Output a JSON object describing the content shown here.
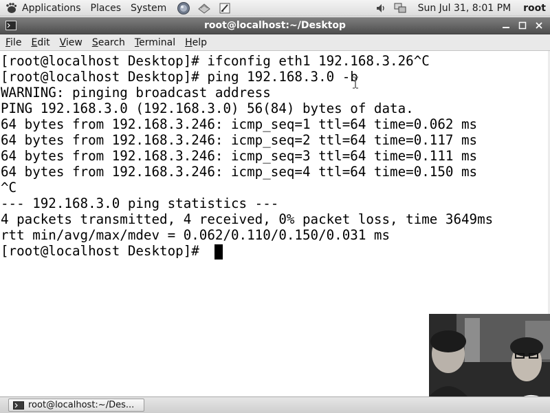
{
  "panel": {
    "menus": [
      "Applications",
      "Places",
      "System"
    ],
    "clock": "Sun Jul 31,  8:01 PM",
    "user": "root"
  },
  "window": {
    "title": "root@localhost:~/Desktop"
  },
  "menubar": {
    "items": [
      {
        "label": "File",
        "mnemonic": "F",
        "rest": "ile"
      },
      {
        "label": "Edit",
        "mnemonic": "E",
        "rest": "dit"
      },
      {
        "label": "View",
        "mnemonic": "V",
        "rest": "iew"
      },
      {
        "label": "Search",
        "mnemonic": "S",
        "rest": "earch"
      },
      {
        "label": "Terminal",
        "mnemonic": "T",
        "rest": "erminal"
      },
      {
        "label": "Help",
        "mnemonic": "H",
        "rest": "elp"
      }
    ]
  },
  "terminal": {
    "lines": [
      "[root@localhost Desktop]# ifconfig eth1 192.168.3.26^C",
      "[root@localhost Desktop]# ping 192.168.3.0 -b",
      "WARNING: pinging broadcast address",
      "PING 192.168.3.0 (192.168.3.0) 56(84) bytes of data.",
      "64 bytes from 192.168.3.246: icmp_seq=1 ttl=64 time=0.062 ms",
      "64 bytes from 192.168.3.246: icmp_seq=2 ttl=64 time=0.117 ms",
      "64 bytes from 192.168.3.246: icmp_seq=3 ttl=64 time=0.111 ms",
      "64 bytes from 192.168.3.246: icmp_seq=4 ttl=64 time=0.150 ms",
      "^C",
      "--- 192.168.3.0 ping statistics ---",
      "4 packets transmitted, 4 received, 0% packet loss, time 3649ms",
      "rtt min/avg/max/mdev = 0.062/0.110/0.150/0.031 ms",
      "[root@localhost Desktop]# "
    ]
  },
  "taskbar": {
    "task_label": "root@localhost:~/Des..."
  }
}
